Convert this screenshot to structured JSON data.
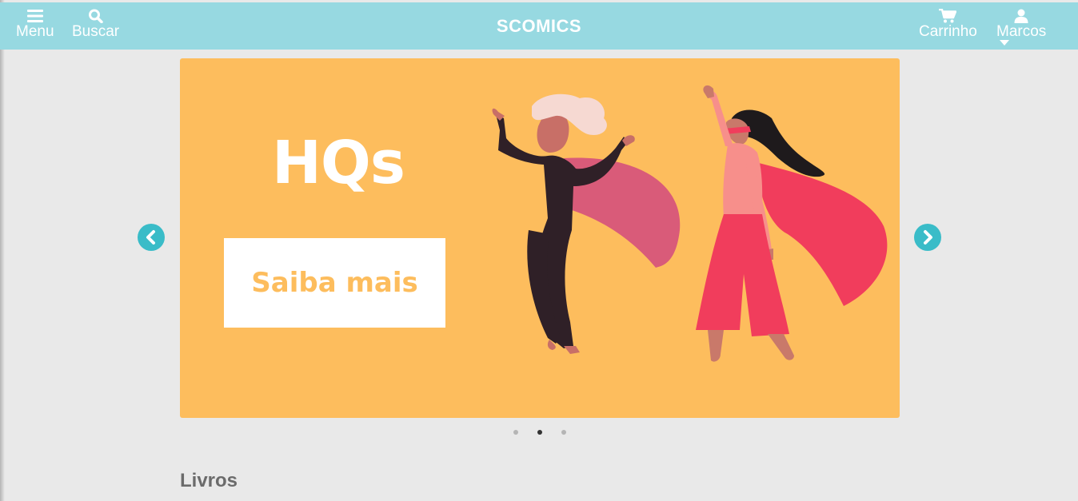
{
  "header": {
    "brand": "SCOMICS",
    "menu_label": "Menu",
    "search_label": "Buscar",
    "cart_label": "Carrinho",
    "user_label": "Marcos"
  },
  "carousel": {
    "slide_title": "HQs",
    "cta_label": "Saiba mais",
    "active_index": 1,
    "slide_count": 3
  },
  "sections": {
    "books_title": "Livros"
  },
  "colors": {
    "header_bg": "#97d9e1",
    "slide_bg": "#fdbd5d",
    "arrow": "#3abcc8",
    "page_bg": "#e9e9e9"
  },
  "icons": [
    "menu-icon",
    "search-icon",
    "cart-icon",
    "user-icon",
    "caret-down-icon",
    "chevron-left-icon",
    "chevron-right-icon"
  ]
}
